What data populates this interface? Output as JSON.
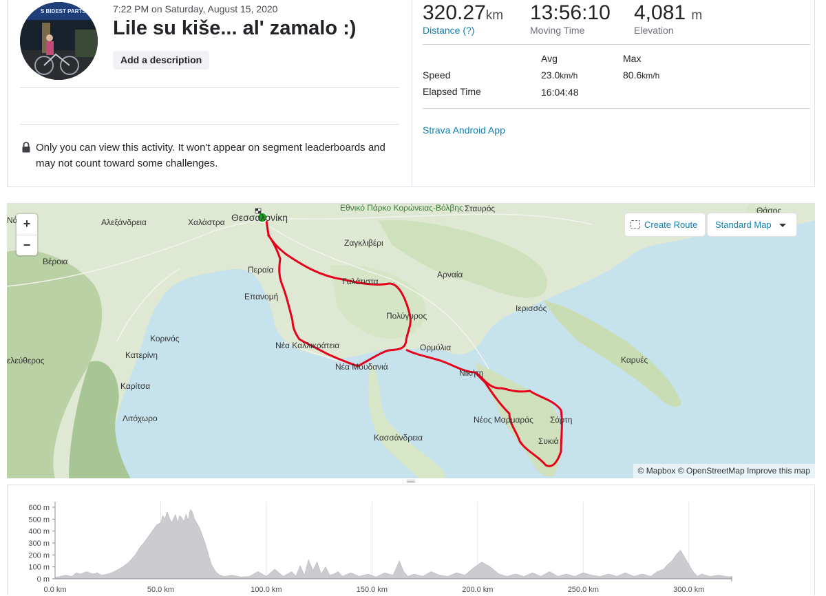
{
  "activity": {
    "date": "7:22 PM on Saturday, August 15, 2020",
    "title": "Lile su kiše... al' zamalo :)",
    "add_description": "Add a description",
    "privacy_note": "Only you can view this activity. It won't appear on segment leaderboards and may not count toward some challenges.",
    "device": "Strava Android App",
    "avatar_sign": "S BIDEST PARTS"
  },
  "stats": {
    "distance": {
      "value": "320.27",
      "unit": "km",
      "label": "Distance (?)"
    },
    "moving_time": {
      "value": "13:56:10",
      "label": "Moving Time"
    },
    "elevation": {
      "value": "4,081",
      "unit": "m",
      "label": "Elevation"
    },
    "headers": {
      "avg": "Avg",
      "max": "Max"
    },
    "speed": {
      "label": "Speed",
      "avg": "23.0",
      "avg_unit": "km/h",
      "max": "80.6",
      "max_unit": "km/h"
    },
    "elapsed": {
      "label": "Elapsed Time",
      "value": "16:04:48"
    }
  },
  "map": {
    "zoom_in": "+",
    "zoom_out": "−",
    "create_route": "Create Route",
    "map_style": "Standard Map",
    "attribution": "© Mapbox © OpenStreetMap Improve this map",
    "places": {
      "thessaloniki": "Θεσσαλονίκη",
      "alexandreia": "Αλεξάνδρεια",
      "chalastra": "Χαλάστρα",
      "naousa": "Νάο",
      "veroia": "Βέροια",
      "national_park": "Εθνικό Πάρκο Κορώνειας-Βόλβης",
      "stavros": "Σταυρός",
      "zagkliveri": "Ζαγκλιβέρι",
      "peraia": "Περαία",
      "arnaia": "Αρναία",
      "galatista": "Γαλάτιστα",
      "epanomi": "Επανομή",
      "ierissos": "Ιερισσός",
      "polygyros": "Πολύγυρος",
      "korinos": "Κορινός",
      "nea_kallikrateia": "Νέα Καλλικράτεια",
      "ormylia": "Ορμύλια",
      "kateriní": "Κατερίνη",
      "karyes": "Καρυές",
      "elefth": "ελεύθερος",
      "nea_moudania": "Νέα Μουδανιά",
      "nikiti": "Νικήτη",
      "karitsa": "Καρίτσα",
      "litochoro": "Λιτόχωρο",
      "neos_marmaras": "Νέος Μαρμαράς",
      "sarti": "Σάρτη",
      "kassandreia": "Κασσάνδρεια",
      "sykia": "Συκιά",
      "thasos": "Θάσος"
    }
  },
  "chart_data": {
    "type": "area",
    "xlabel": "",
    "ylabel": "",
    "x_ticks": [
      "0.0 km",
      "50.0 km",
      "100.0 km",
      "150.0 km",
      "200.0 km",
      "250.0 km",
      "300.0 km"
    ],
    "y_ticks": [
      "0 m",
      "100 m",
      "200 m",
      "300 m",
      "400 m",
      "500 m",
      "600 m"
    ],
    "xlim": [
      0,
      320.27
    ],
    "ylim": [
      0,
      600
    ],
    "series": [
      {
        "x": [
          0,
          5,
          8,
          10,
          12,
          15,
          18,
          20,
          22,
          25,
          28,
          30,
          32,
          35,
          38,
          40,
          42,
          44,
          46,
          48,
          50,
          51,
          52,
          53,
          54,
          55,
          56,
          57,
          58,
          59,
          60,
          61,
          62,
          63,
          64,
          65,
          66,
          67,
          68,
          69,
          70,
          71,
          72,
          73,
          74,
          76,
          78,
          80,
          84,
          88,
          92,
          96,
          100,
          104,
          108,
          110,
          112,
          114,
          116,
          118,
          120,
          122,
          124,
          126,
          128,
          130,
          132,
          134,
          136,
          140,
          144,
          148,
          152,
          156,
          160,
          163,
          165,
          167,
          170,
          174,
          178,
          182,
          186,
          190,
          194,
          198,
          202,
          206,
          210,
          214,
          218,
          222,
          226,
          230,
          234,
          238,
          242,
          246,
          250,
          254,
          258,
          262,
          266,
          270,
          274,
          278,
          282,
          285,
          288,
          290,
          292,
          294,
          296,
          298,
          300,
          302,
          304,
          306,
          310,
          314,
          318,
          320.27
        ],
        "y": [
          10,
          30,
          20,
          50,
          40,
          60,
          40,
          50,
          30,
          40,
          60,
          80,
          100,
          140,
          200,
          260,
          300,
          350,
          400,
          450,
          470,
          530,
          500,
          560,
          520,
          470,
          500,
          540,
          470,
          530,
          510,
          480,
          540,
          490,
          580,
          560,
          500,
          470,
          440,
          400,
          350,
          300,
          240,
          180,
          120,
          60,
          30,
          20,
          30,
          15,
          20,
          60,
          20,
          80,
          20,
          40,
          60,
          20,
          110,
          30,
          160,
          70,
          140,
          40,
          100,
          30,
          40,
          60,
          20,
          50,
          20,
          40,
          15,
          50,
          30,
          150,
          60,
          20,
          40,
          20,
          60,
          30,
          20,
          50,
          30,
          90,
          140,
          100,
          40,
          20,
          40,
          20,
          50,
          20,
          60,
          20,
          40,
          20,
          50,
          30,
          20,
          40,
          20,
          50,
          20,
          40,
          20,
          60,
          80,
          120,
          150,
          200,
          240,
          180,
          120,
          60,
          20,
          40,
          20,
          30,
          20,
          15
        ]
      }
    ]
  }
}
